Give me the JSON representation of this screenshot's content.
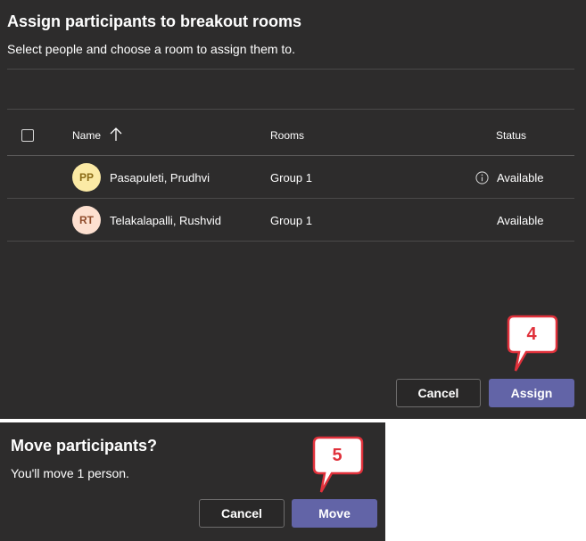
{
  "assign_dialog": {
    "title": "Assign participants to breakout rooms",
    "subtitle": "Select people and choose a room to assign them to.",
    "columns": {
      "name": "Name",
      "rooms": "Rooms",
      "status": "Status"
    },
    "rows": [
      {
        "initials": "PP",
        "name": "Pasapuleti, Prudhvi",
        "room": "Group 1",
        "status": "Available",
        "has_info": true,
        "avatar_bg": "#fbeaa5",
        "avatar_fg": "#8a6a14"
      },
      {
        "initials": "RT",
        "name": "Telakalapalli, Rushvid",
        "room": "Group 1",
        "status": "Available",
        "has_info": false,
        "avatar_bg": "#fde0d0",
        "avatar_fg": "#8e4a2a"
      }
    ],
    "cancel_label": "Cancel",
    "assign_label": "Assign",
    "callout_number": "4"
  },
  "move_dialog": {
    "title": "Move participants?",
    "message": "You'll move 1 person.",
    "cancel_label": "Cancel",
    "move_label": "Move",
    "callout_number": "5"
  },
  "colors": {
    "dialog_bg": "#2d2c2c",
    "primary": "#6264a7",
    "callout_red": "#e0313b"
  }
}
